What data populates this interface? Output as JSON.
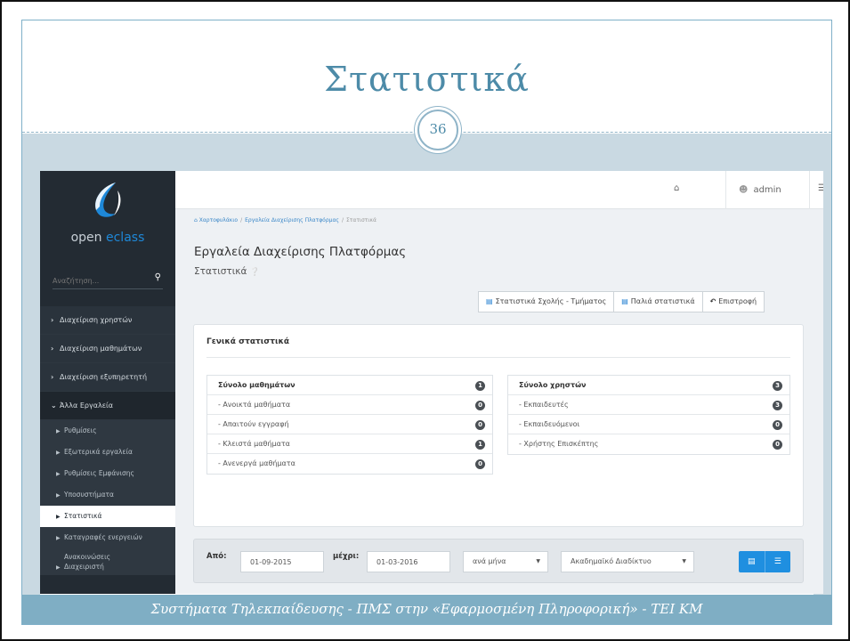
{
  "slide": {
    "title": "Στατιστικά",
    "page_number": "36",
    "footer": "Συστήματα Τηλεκπαίδευσης - ΠΜΣ στην «Εφαρμοσμένη Πληροφορική» - ΤΕΙ ΚΜ"
  },
  "app": {
    "logo_word1": "open ",
    "logo_word2": "eclass",
    "accent": "#1e88d8",
    "sidebar_bg": "#232b33"
  },
  "search": {
    "placeholder": "Αναζήτηση..."
  },
  "menu": [
    {
      "label": "Διαχείριση χρηστών",
      "arrow": "›"
    },
    {
      "label": "Διαχείριση μαθημάτων",
      "arrow": "›"
    },
    {
      "label": "Διαχείριση εξυπηρετητή",
      "arrow": "›"
    },
    {
      "label": "Άλλα Εργαλεία",
      "arrow": "⌄"
    }
  ],
  "submenu": [
    {
      "label": "Ρυθμίσεις"
    },
    {
      "label": "Εξωτερικά εργαλεία"
    },
    {
      "label": "Ρυθμίσεις Εμφάνισης"
    },
    {
      "label": "Υποσυστήματα"
    },
    {
      "label": "Στατιστικά",
      "active": true
    },
    {
      "label": "Καταγραφές ενεργειών"
    },
    {
      "label": "Ανακοινώσεις Διαχειριστή"
    }
  ],
  "topbar": {
    "user": "admin"
  },
  "breadcrumb": {
    "items": [
      "Χαρτοφυλάκιο",
      "Εργαλεία Διαχείρισης Πλατφόρμας",
      "Στατιστικά"
    ],
    "separator": "/"
  },
  "page": {
    "heading": "Εργαλεία Διαχείρισης Πλατφόρμας",
    "subheading": "Στατιστικά"
  },
  "actions": {
    "faculty_stats": "Στατιστικά Σχολής - Τμήματος",
    "old_stats": "Παλιά στατιστικά",
    "back": "Επιστροφή"
  },
  "general": {
    "title": "Γενικά στατιστικά",
    "courses": {
      "header": "Σύνολο μαθημάτων",
      "total": "1",
      "rows": [
        {
          "label": "- Ανοικτά μαθήματα",
          "count": "0"
        },
        {
          "label": "- Απαιτούν εγγραφή",
          "count": "0"
        },
        {
          "label": "- Κλειστά μαθήματα",
          "count": "1"
        },
        {
          "label": "- Ανενεργά μαθήματα",
          "count": "0"
        }
      ]
    },
    "users": {
      "header": "Σύνολο χρηστών",
      "total": "3",
      "rows": [
        {
          "label": "- Εκπαιδευτές",
          "count": "3"
        },
        {
          "label": "- Εκπαιδευόμενοι",
          "count": "0"
        },
        {
          "label": "- Χρήστης Επισκέπτης",
          "count": "0"
        }
      ]
    }
  },
  "filter": {
    "from_label": "Από:",
    "from_value": "01-09-2015",
    "to_label": "μέχρι:",
    "to_value": "01-03-2016",
    "interval": "ανά μήνα",
    "department": "Ακαδημαϊκό Διαδίκτυο"
  }
}
